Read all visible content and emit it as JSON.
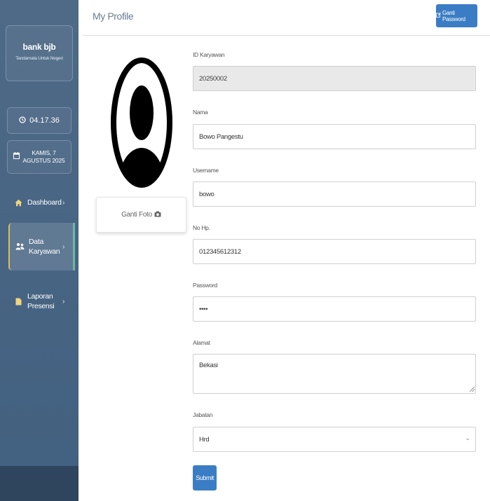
{
  "sidebar": {
    "brand": {
      "name": "bank bjb",
      "tagline": "Tandamata Untuk Negeri"
    },
    "clock": {
      "time": "04.17.36",
      "icon": "clock-icon"
    },
    "date": {
      "text": "KAMIS, 7 AGUSTUS 2025",
      "icon": "calendar-icon"
    },
    "items": [
      {
        "label": "Dashboard",
        "icon": "home-icon",
        "active": false
      },
      {
        "label": "Data Karyawan",
        "icon": "users-icon",
        "active": true
      },
      {
        "label": "Laporan Presensi",
        "icon": "file-icon",
        "active": false
      }
    ]
  },
  "header": {
    "title": "My Profile",
    "change_password_label": "Ganti Password",
    "change_password_icon": "edit-icon"
  },
  "profile": {
    "avatar_icon": "user-avatar-icon",
    "change_photo_label": "Ganti Foto",
    "change_photo_icon": "camera-icon"
  },
  "form": {
    "id_karyawan": {
      "label": "ID Karyawan",
      "value": "20250002"
    },
    "nama": {
      "label": "Nama",
      "value": "Bowo Pangestu"
    },
    "username": {
      "label": "Username",
      "value": "bowo"
    },
    "no_hp": {
      "label": "No Hp.",
      "value": "012345612312"
    },
    "password": {
      "label": "Password",
      "value": "••••"
    },
    "alamat": {
      "label": "Alamat",
      "value": "Bekasi"
    },
    "jabatan": {
      "label": "Jabatan",
      "value": "Hrd"
    },
    "submit_label": "Submit"
  },
  "colors": {
    "sidebar": "#476483",
    "sidebar_bottom": "#2f455e",
    "primary_button": "#3b7dc4",
    "active_accent": "#6fb7a1",
    "active_border": "#d9bf63"
  }
}
